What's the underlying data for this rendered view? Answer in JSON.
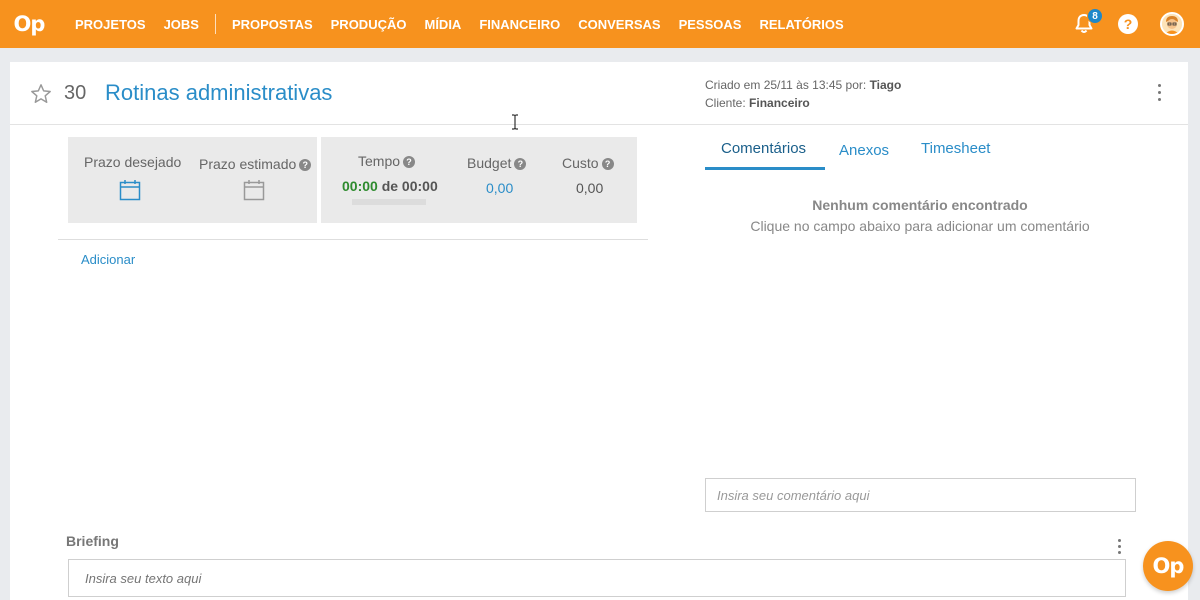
{
  "app": {
    "logo_text": "Op"
  },
  "nav": {
    "items": [
      "PROJETOS",
      "JOBS",
      "PROPOSTAS",
      "PRODUÇÃO",
      "MÍDIA",
      "FINANCEIRO",
      "CONVERSAS",
      "PESSOAS",
      "RELATÓRIOS"
    ]
  },
  "notifications": {
    "count": "8"
  },
  "help": {
    "label": "?"
  },
  "job": {
    "number": "30",
    "title": "Rotinas administrativas",
    "created_prefix": "Criado em 25/11 às 13:45 por:",
    "created_by": "Tiago",
    "client_prefix": "Cliente:",
    "client": "Financeiro"
  },
  "stats": {
    "prazo_desejado": "Prazo desejado",
    "prazo_estimado": "Prazo estimado",
    "tempo_label": "Tempo",
    "tempo_spent": "00:00",
    "tempo_de": "de 00:00",
    "tempo_progress_fraction": 0,
    "budget_label": "Budget",
    "budget_value": "0,00",
    "custo_label": "Custo",
    "custo_value": "0,00"
  },
  "add_link": "Adicionar",
  "tabs": [
    "Comentários",
    "Anexos",
    "Timesheet"
  ],
  "comments": {
    "empty_title": "Nenhum comentário encontrado",
    "empty_subtitle": "Clique no campo abaixo para adicionar um comentário",
    "input_placeholder": "Insira seu comentário aqui"
  },
  "briefing": {
    "label": "Briefing",
    "input_placeholder": "Insira seu texto aqui"
  },
  "fab": {
    "label": "Op"
  },
  "colors": {
    "brand": "#f7921e",
    "link": "#2a8dc8",
    "green": "#2e8b2e"
  }
}
